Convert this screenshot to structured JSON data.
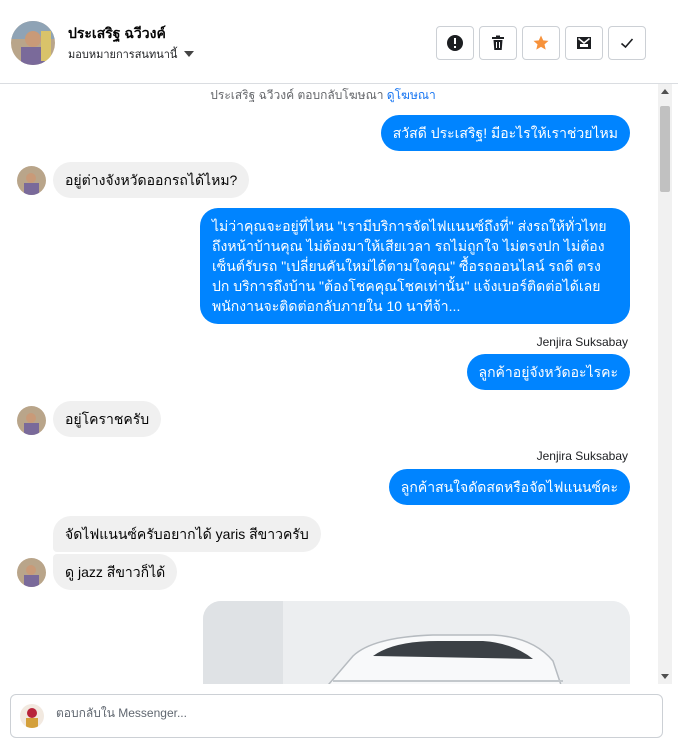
{
  "header": {
    "contact_name": "ประเสริฐ ฉวีวงค์",
    "assign_label": "มอบหมายการสนทนานี้",
    "buttons": [
      {
        "name": "spam-button",
        "icon": "alert-circle-icon"
      },
      {
        "name": "delete-button",
        "icon": "trash-icon"
      },
      {
        "name": "star-button",
        "icon": "star-icon",
        "color": "#f7923b"
      },
      {
        "name": "mark-unread-button",
        "icon": "envelope-icon"
      },
      {
        "name": "done-button",
        "icon": "check-icon"
      }
    ]
  },
  "notice": {
    "text": "ประเสริฐ ฉวีวงค์ ตอบกลับโฆษณา",
    "link": "ดูโฆษณา"
  },
  "messages": {
    "m1": "สวัสดี ประเสริฐ! มีอะไรให้เราช่วยไหม",
    "m2": "อยู่ต่างจังหวัดออกรถได้ไหม?",
    "m3": "ไม่ว่าคุณจะอยู่ที่ไหน \"เรามีบริการจัดไฟแนนซ์ถึงที่\"  ส่งรถให้ทั่วไทยถึงหน้าบ้านคุณ ไม่ต้องมาให้เสียเวลา รถไม่ถูกใจ ไม่ตรงปก ไม่ต้องเซ็นต์รับรถ \"เปลี่ยนคันใหม่ได้ตามใจคุณ\" ซื้อรถออนไลน์ รถดี ตรงปก บริการถึงบ้าน \"ต้องโชคคุณโชคเท่านั้น\" แจ้งเบอร์ติดต่อได้เลย พนักงานจะติดต่อกลับภายใน 10 นาทีจ้า...",
    "sender1": "Jenjira Suksabay",
    "m4": "ลูกค้าอยู่จังหวัดอะไรคะ",
    "m5": "อยู่โคราชครับ",
    "sender2": "Jenjira Suksabay",
    "m6": "ลูกค้าสนใจดัดสดหรือจัดไฟแนนซ์คะ",
    "m7": "จัดไฟแนนซ์ครับอยากได้ yaris สีขาวครับ",
    "m8": "ดู jazz สีขาวก็ได้"
  },
  "composer": {
    "placeholder": "ตอบกลับใน Messenger..."
  },
  "colors": {
    "outgoing_bubble": "#0084ff",
    "incoming_bubble": "#f0f0f0",
    "link": "#1876f2"
  }
}
